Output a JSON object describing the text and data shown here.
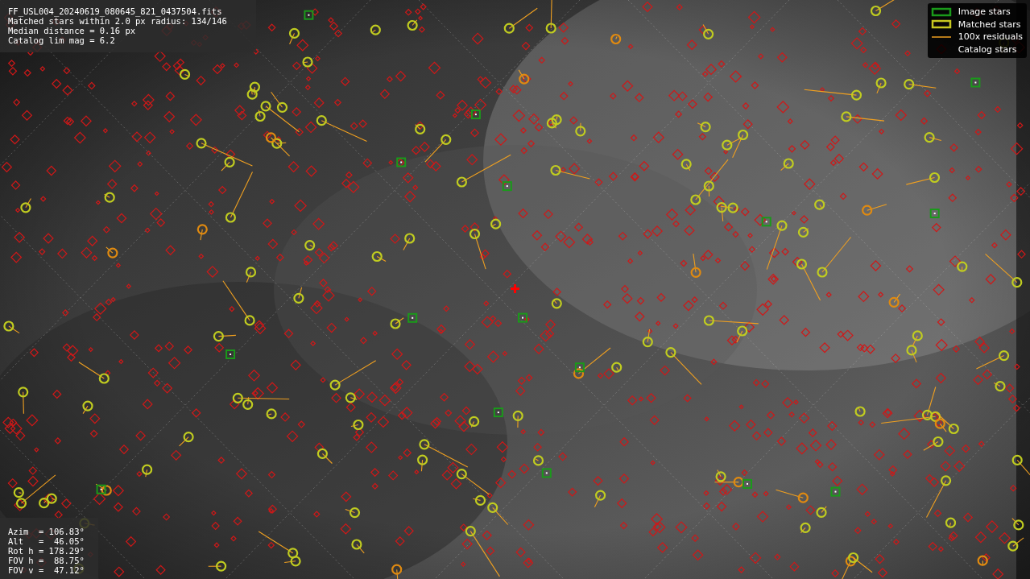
{
  "info": {
    "lines": [
      "FF_USL004_20240619_080645_821_0437504.fits",
      "Matched stars within 2.0 px radius: 134/146",
      "Median distance = 0.16 px",
      "Catalog lim mag = 6.2"
    ]
  },
  "legend": {
    "items": [
      {
        "label": "Image stars"
      },
      {
        "label": "Matched stars",
        "kind": "matched"
      },
      {
        "label": "100x residuals",
        "kind": "residual"
      },
      {
        "label": "Catalog stars",
        "kind": "catalog"
      }
    ]
  },
  "pointing": {
    "lines": [
      "Azim  = 106.83°",
      "Alt   =  46.05°",
      "Rot h = 178.29°",
      "FOV h =  88.75°",
      "FOV v =  47.12°"
    ]
  }
}
